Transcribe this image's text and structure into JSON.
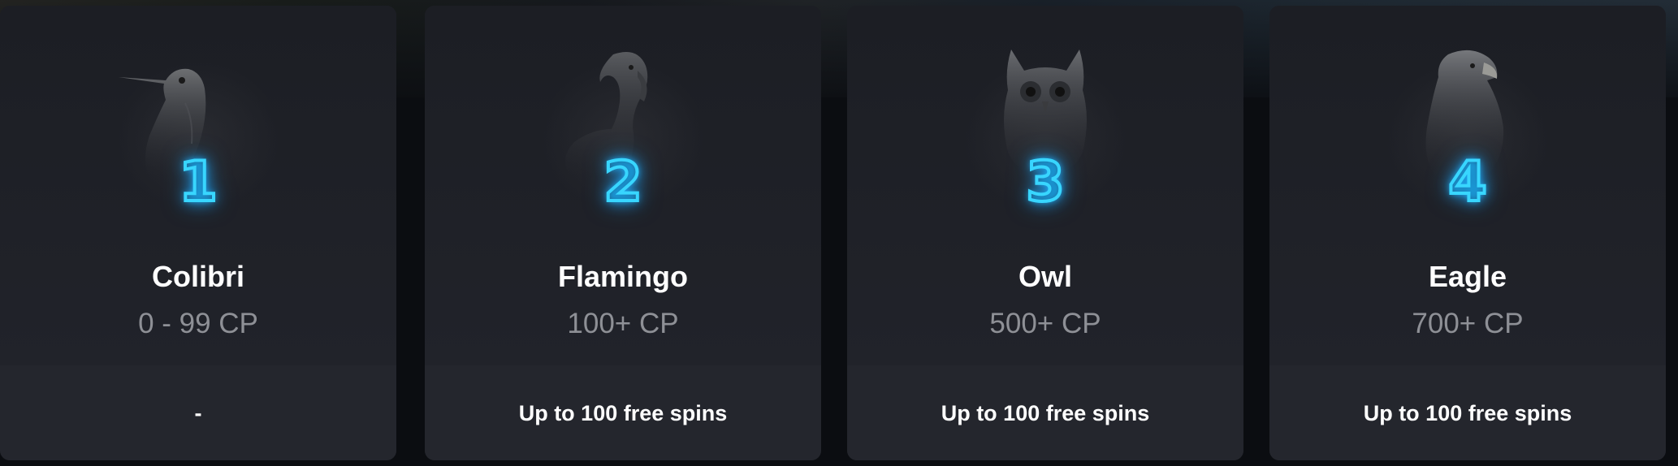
{
  "tiers": [
    {
      "number": "1",
      "name": "Colibri",
      "range": "0 - 99 CP",
      "reward": "-",
      "bird_icon": "hummingbird-icon"
    },
    {
      "number": "2",
      "name": "Flamingo",
      "range": "100+ CP",
      "reward": "Up to 100 free spins",
      "bird_icon": "flamingo-icon"
    },
    {
      "number": "3",
      "name": "Owl",
      "range": "500+ CP",
      "reward": "Up to 100 free spins",
      "bird_icon": "owl-icon"
    },
    {
      "number": "4",
      "name": "Eagle",
      "range": "700+ CP",
      "reward": "Up to 100 free spins",
      "bird_icon": "eagle-icon"
    }
  ],
  "colors": {
    "card_background": "#1d1f25",
    "card_footer": "#24262d",
    "neon_accent": "#38d6ff",
    "muted_text": "#8e9096"
  }
}
